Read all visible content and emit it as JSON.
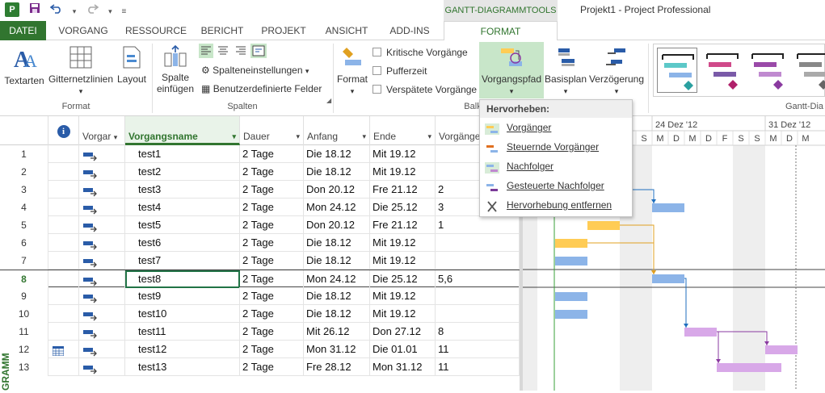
{
  "titlebar": {
    "app_icon_label": "P",
    "qat_save_icon": "save-icon",
    "qat_undo_icon": "undo-icon",
    "qat_redo_icon": "redo-icon",
    "context_title": "GANTT-DIAGRAMMTOOLS",
    "window_title": "Projekt1 - Project Professional"
  },
  "tabs": {
    "file": "DATEI",
    "vorgang": "VORGANG",
    "ressource": "RESSOURCE",
    "bericht": "BERICHT",
    "projekt": "PROJEKT",
    "ansicht": "ANSICHT",
    "addins": "ADD-INS",
    "format": "FORMAT"
  },
  "ribbon": {
    "textarten": "Textarten",
    "gitternetzlinien": "Gitternetzlinien",
    "layout": "Layout",
    "group_format": "Format",
    "spalte_einfuegen_1": "Spalte",
    "spalte_einfuegen_2": "einfügen",
    "spalteneinstellungen": "Spalteneinstellungen",
    "benutzerdefinierte_felder": "Benutzerdefinierte Felder",
    "group_spalten": "Spalten",
    "format_btn": "Format",
    "kritische_vorgaenge": "Kritische Vorgänge",
    "pufferzeit": "Pufferzeit",
    "verspaetete_vorgaenge": "Verspätete Vorgänge",
    "group_balk": "Balk",
    "vorgangspfad": "Vorgangspfad",
    "basisplan": "Basisplan",
    "verzoegerung": "Verzögerung",
    "group_gantt": "Gantt-Dia"
  },
  "menu": {
    "header": "Hervorheben:",
    "items": [
      "Vorgänger",
      "Steuernde Vorgänger",
      "Nachfolger",
      "Gesteuerte Nachfolger",
      "Hervorhebung entfernen"
    ]
  },
  "grid": {
    "headers": {
      "info_icon": "info-icon",
      "mode": "Vorgar",
      "name": "Vorgangsname",
      "duration": "Dauer",
      "start": "Anfang",
      "end": "Ende",
      "pred": "Vorgänge"
    },
    "rows": [
      {
        "id": "1",
        "name": "test1",
        "duration": "2 Tage",
        "start": "Die 18.12",
        "end": "Mit 19.12",
        "pred": ""
      },
      {
        "id": "2",
        "name": "test2",
        "duration": "2 Tage",
        "start": "Die 18.12",
        "end": "Mit 19.12",
        "pred": ""
      },
      {
        "id": "3",
        "name": "test3",
        "duration": "2 Tage",
        "start": "Don 20.12",
        "end": "Fre 21.12",
        "pred": "2"
      },
      {
        "id": "4",
        "name": "test4",
        "duration": "2 Tage",
        "start": "Mon 24.12",
        "end": "Die 25.12",
        "pred": "3"
      },
      {
        "id": "5",
        "name": "test5",
        "duration": "2 Tage",
        "start": "Don 20.12",
        "end": "Fre 21.12",
        "pred": "1"
      },
      {
        "id": "6",
        "name": "test6",
        "duration": "2 Tage",
        "start": "Die 18.12",
        "end": "Mit 19.12",
        "pred": ""
      },
      {
        "id": "7",
        "name": "test7",
        "duration": "2 Tage",
        "start": "Die 18.12",
        "end": "Mit 19.12",
        "pred": ""
      },
      {
        "id": "8",
        "name": "test8",
        "duration": "2 Tage",
        "start": "Mon 24.12",
        "end": "Die 25.12",
        "pred": "5,6"
      },
      {
        "id": "9",
        "name": "test9",
        "duration": "2 Tage",
        "start": "Die 18.12",
        "end": "Mit 19.12",
        "pred": ""
      },
      {
        "id": "10",
        "name": "test10",
        "duration": "2 Tage",
        "start": "Die 18.12",
        "end": "Mit 19.12",
        "pred": ""
      },
      {
        "id": "11",
        "name": "test11",
        "duration": "2 Tage",
        "start": "Mit 26.12",
        "end": "Don 27.12",
        "pred": "8"
      },
      {
        "id": "12",
        "name": "test12",
        "duration": "2 Tage",
        "start": "Mon 31.12",
        "end": "Die 01.01",
        "pred": "11"
      },
      {
        "id": "13",
        "name": "test13",
        "duration": "2 Tage",
        "start": "Fre 28.12",
        "end": "Mon 31.12",
        "pred": "11"
      }
    ],
    "side_label": "GRAMM"
  },
  "gantt": {
    "week1_label": "24 Dez '12",
    "week2_label": "31 Dez '12",
    "day_letters": [
      "S",
      "M",
      "D",
      "M",
      "D",
      "F",
      "S",
      "S",
      "M",
      "D",
      "M"
    ],
    "colors": {
      "blue": "#8cb4e8",
      "orange": "#ffcc55",
      "purple": "#d8a8e8",
      "link_blue": "#1f6fbf",
      "link_orange": "#e0a020",
      "link_purple": "#8a3aa0"
    }
  }
}
